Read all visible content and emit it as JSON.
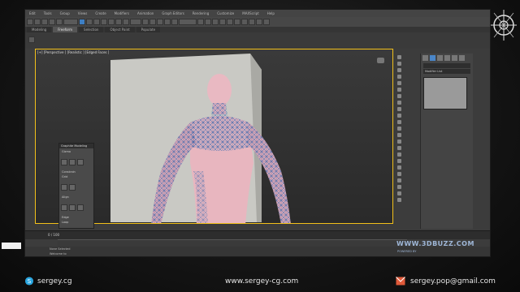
{
  "menu": {
    "items": [
      "Edit",
      "Tools",
      "Group",
      "Views",
      "Create",
      "Modifiers",
      "Animation",
      "Graph Editors",
      "Rendering",
      "Customize",
      "MAXScript",
      "Help"
    ]
  },
  "ribbon": {
    "tabs": [
      "Modeling",
      "Freeform",
      "Selection",
      "Object Paint",
      "Populate"
    ],
    "active_index": 1
  },
  "viewport": {
    "label": "[+] [Perspective ] [Realistic ] [Edged Faces ]"
  },
  "floater": {
    "title": "Graphite Modeling",
    "sections": [
      "Gizmo",
      "Constrain",
      "Grid",
      "Align",
      "Edge",
      "Loop"
    ]
  },
  "command_panel": {
    "modifier_list_label": "Modifier List"
  },
  "timeline": {
    "frame_label": "0 / 100"
  },
  "status": {
    "line1": "None Selected",
    "line2": "Welcome to"
  },
  "watermark": {
    "line1": "WWW.3DBUZZ.COM",
    "line2": "POWERED BY"
  },
  "footer": {
    "skype": "sergey.cg",
    "website": "www.sergey-cg.com",
    "email": "sergey.pop@gmail.com"
  },
  "colors": {
    "viewport_border": "#f2c01a",
    "accent": "#3d7fc4",
    "skin": "#e8b7c0",
    "wire": "#3b6fb6"
  }
}
